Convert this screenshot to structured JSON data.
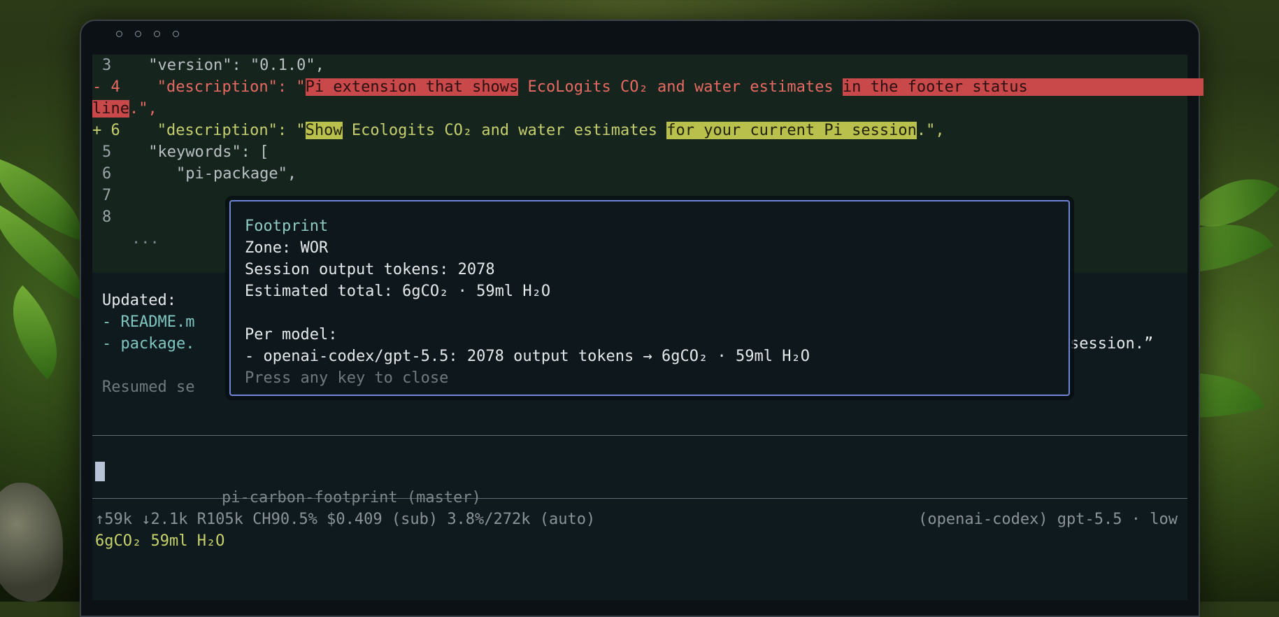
{
  "window": {
    "controls": [
      "close",
      "minimize",
      "maximize",
      "menu"
    ]
  },
  "diff": {
    "lines": [
      {
        "no": "3",
        "content": "\"version\": \"0.1.0\","
      },
      {
        "marker": "- 4",
        "key": "\"description\": \"",
        "hl1": "Pi extension that shows",
        "mid": " EcoLogits CO₂ and water estimates ",
        "hl2": "in the footer status",
        "wrap_hl": "line",
        "wrap_tail": ".\","
      },
      {
        "marker": "+ 6",
        "key": "\"description\": \"",
        "hl1": "Show",
        "mid": " Ecologits CO₂ and water estimates ",
        "hl2": "for your current Pi session",
        "tail": ".\","
      },
      {
        "no": "5",
        "content": "\"keywords\": ["
      },
      {
        "no": "6",
        "content": "\"pi-package\","
      },
      {
        "no": "7",
        "content": ""
      },
      {
        "no": "8",
        "content": ""
      },
      {
        "ellipsis": "..."
      }
    ]
  },
  "log": {
    "updated_label": "Updated:",
    "item1": "- README.m",
    "item2": "- package.",
    "item2_tail": "session.”",
    "resumed": "Resumed se"
  },
  "popup": {
    "title": "Footprint",
    "zone": "Zone: WOR",
    "session_tokens": "Session output tokens: 2078",
    "estimated_total": "Estimated total: 6gCO₂ · 59ml H₂O",
    "per_model_label": "Per model:",
    "per_model_entry": "- openai-codex/gpt-5.5: 2078 output tokens → 6gCO₂ · 59ml H₂O",
    "hint": "Press any key to close"
  },
  "status": {
    "project": "pi-carbon-footprint (master)",
    "stats": "↑59k ↓2.1k R105k CH90.5% $0.409 (sub) 3.8%/272k (auto)",
    "model": "(openai-codex) gpt-5.5 · low",
    "footprint": "6gCO₂ 59ml H₂O"
  },
  "colors": {
    "removed_highlight": "#c9484a",
    "added_highlight": "#b9c14c",
    "popup_border": "#6f86d8",
    "footprint_text": "#c8d26a"
  }
}
